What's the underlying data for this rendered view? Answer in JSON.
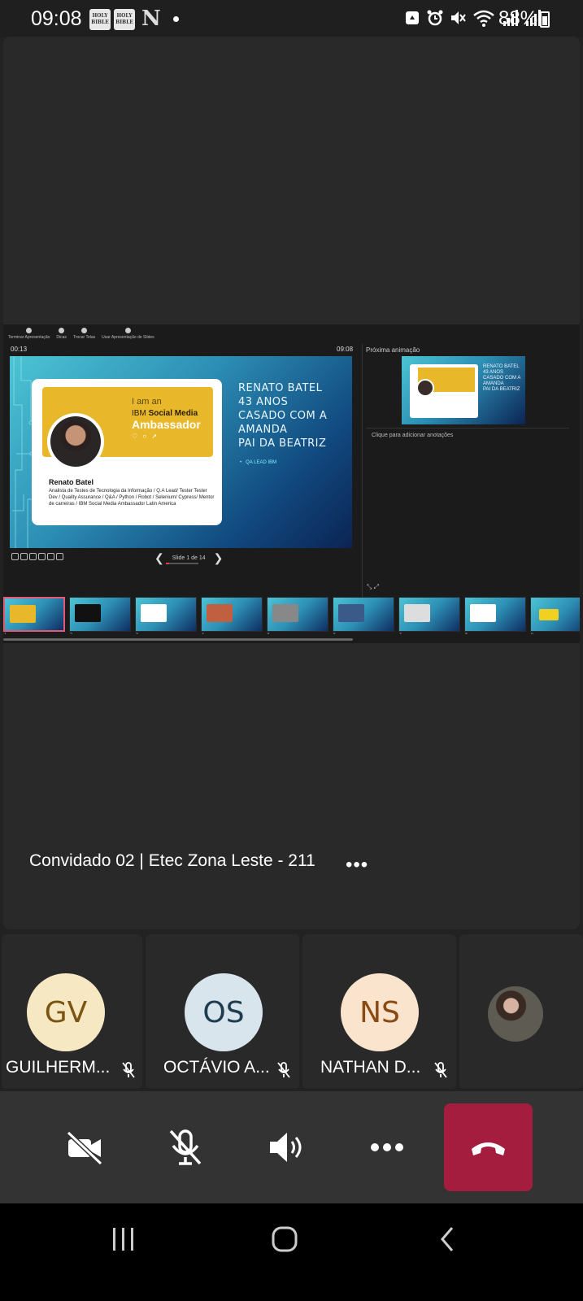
{
  "status_bar": {
    "time": "09:08",
    "book_label": "HOLY BIBLE",
    "app_letter": "N",
    "battery": "88%",
    "icons": [
      "recycle-icon",
      "alarm-icon",
      "mute-icon",
      "wifi-icon",
      "signal-icon",
      "signal-icon",
      "battery-icon"
    ]
  },
  "presentation": {
    "toolbar": [
      "Terminar Apresentação",
      "Dicas",
      "Trocar Telas",
      "Usar Apresentação de Slides"
    ],
    "timer": "00:13",
    "clock": "09:08",
    "next_label": "Próxima animação",
    "notes_placeholder": "Clique para adicionar anotações",
    "slide_counter": "Slide 1 de 14",
    "current_slide": {
      "card_iam": "I am an",
      "card_ibm_prefix": "IBM ",
      "card_ibm_bold": "Social Media",
      "card_ambassador": "Ambassador",
      "card_name": "Renato Batel",
      "card_desc": "Analista de Testes de Tecnologia da Informação / Q.A Lead/ Tester Tester Dev / Quality Assurance / Q&A / Python / Robot / Selenium/ Cypress/ Mentor de carreiras / IBM Social Media Ambassador Latin America",
      "title_lines": [
        "RENATO BATEL",
        "43 ANOS",
        "CASADO COM A",
        "AMANDA",
        "PAI DA BEATRIZ"
      ],
      "bullet": "QA LEAD IBM"
    },
    "next_slide": {
      "text_lines": [
        "RENATO BATEL",
        "43 ANOS",
        "CASADO COM A",
        "AMANDA",
        "PAI DA BEATRIZ"
      ]
    },
    "thumbnail_numbers": [
      "1",
      "2",
      "3",
      "4",
      "5",
      "6",
      "7",
      "8",
      "9"
    ]
  },
  "presenter": {
    "name": "Convidado 02 | Etec Zona Leste - 211",
    "more": "•••"
  },
  "participants": [
    {
      "initials": "GV",
      "name": "GUILHERM...",
      "bg": "#f7e8c4",
      "fg": "#7a5410",
      "muted": true
    },
    {
      "initials": "OS",
      "name": "OCTÁVIO A...",
      "bg": "#d8e5ec",
      "fg": "#1e3d4e",
      "muted": true
    },
    {
      "initials": "NS",
      "name": "NATHAN D...",
      "bg": "#fbe4cd",
      "fg": "#8a4a14",
      "muted": true
    }
  ],
  "controls": {
    "camera": "camera-off-icon",
    "mic": "mic-off-icon",
    "speaker": "speaker-icon",
    "more": "more-icon",
    "hangup": "hang-up-icon",
    "hangup_color": "#a41d3f"
  },
  "colors": {
    "background": "#222222",
    "tile": "#292929",
    "slide_accent": "#e8b82a"
  }
}
